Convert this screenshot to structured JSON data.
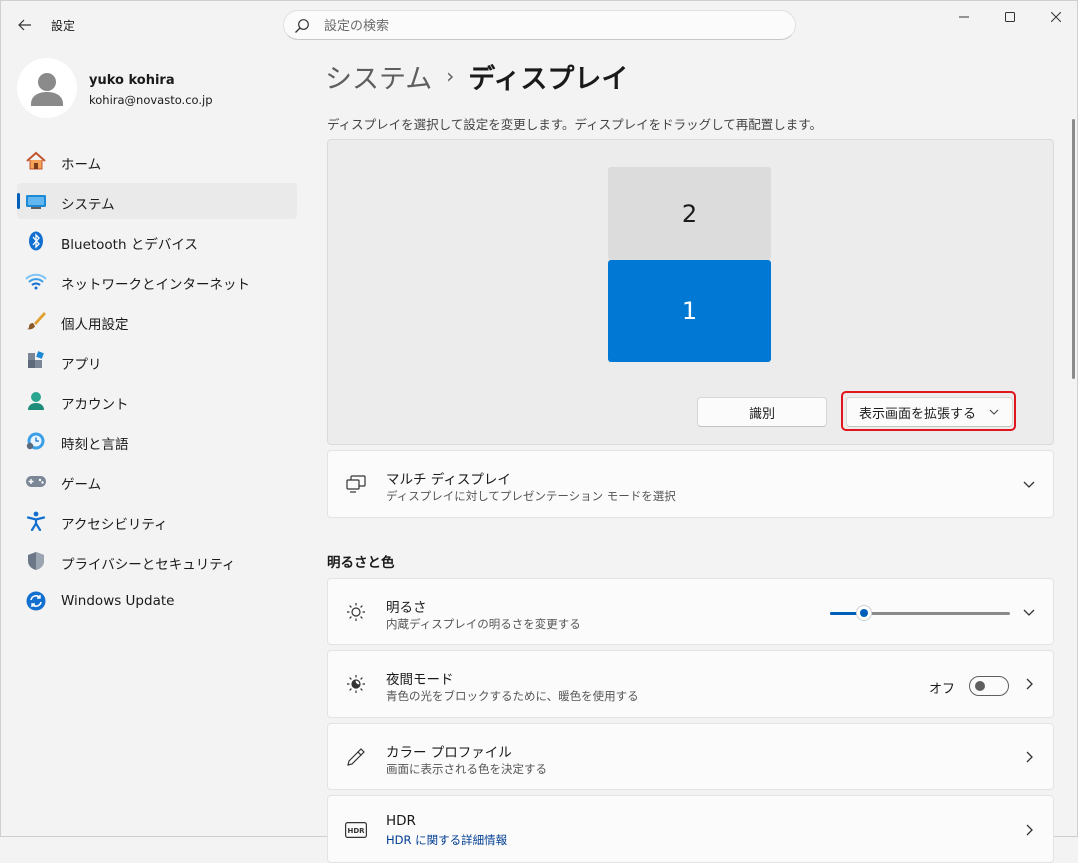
{
  "window": {
    "app_title": "設定"
  },
  "search": {
    "placeholder": "設定の検索",
    "value": ""
  },
  "profile": {
    "name": "yuko kohira",
    "email": "kohira@novasto.co.jp"
  },
  "sidebar": {
    "items": [
      {
        "label": "ホーム",
        "icon": "home-icon",
        "active": false
      },
      {
        "label": "システム",
        "icon": "system-icon",
        "active": true
      },
      {
        "label": "Bluetooth とデバイス",
        "icon": "bluetooth-icon",
        "active": false
      },
      {
        "label": "ネットワークとインターネット",
        "icon": "wifi-icon",
        "active": false
      },
      {
        "label": "個人用設定",
        "icon": "brush-icon",
        "active": false
      },
      {
        "label": "アプリ",
        "icon": "apps-icon",
        "active": false
      },
      {
        "label": "アカウント",
        "icon": "account-icon",
        "active": false
      },
      {
        "label": "時刻と言語",
        "icon": "time-language-icon",
        "active": false
      },
      {
        "label": "ゲーム",
        "icon": "gamepad-icon",
        "active": false
      },
      {
        "label": "アクセシビリティ",
        "icon": "accessibility-icon",
        "active": false
      },
      {
        "label": "プライバシーとセキュリティ",
        "icon": "shield-icon",
        "active": false
      },
      {
        "label": "Windows Update",
        "icon": "update-icon",
        "active": false
      }
    ]
  },
  "breadcrumb": {
    "parent": "システム",
    "separator": "›",
    "current": "ディスプレイ"
  },
  "display_arrangement": {
    "description": "ディスプレイを選択して設定を変更します。ディスプレイをドラッグして再配置します。",
    "monitor_top": "2",
    "monitor_bottom": "1",
    "identify_label": "識別",
    "mode_label": "表示画面を拡張する"
  },
  "multi_display": {
    "title": "マルチ ディスプレイ",
    "subtitle": "ディスプレイに対してプレゼンテーション モードを選択"
  },
  "section_brightness_color": "明るさと色",
  "brightness": {
    "title": "明るさ",
    "subtitle": "内蔵ディスプレイの明るさを変更する",
    "level_percent": 19
  },
  "night_light": {
    "title": "夜間モード",
    "subtitle": "青色の光をブロックするために、暖色を使用する",
    "state_label": "オフ",
    "on": false
  },
  "color_profile": {
    "title": "カラー プロファイル",
    "subtitle": "画面に表示される色を決定する"
  },
  "hdr": {
    "title": "HDR",
    "subtitle": "HDR に関する詳細情報",
    "icon_text": "HDR"
  },
  "colors": {
    "accent": "#005fb8",
    "monitor_selected": "#0078d4",
    "highlight": "#e0161e"
  }
}
